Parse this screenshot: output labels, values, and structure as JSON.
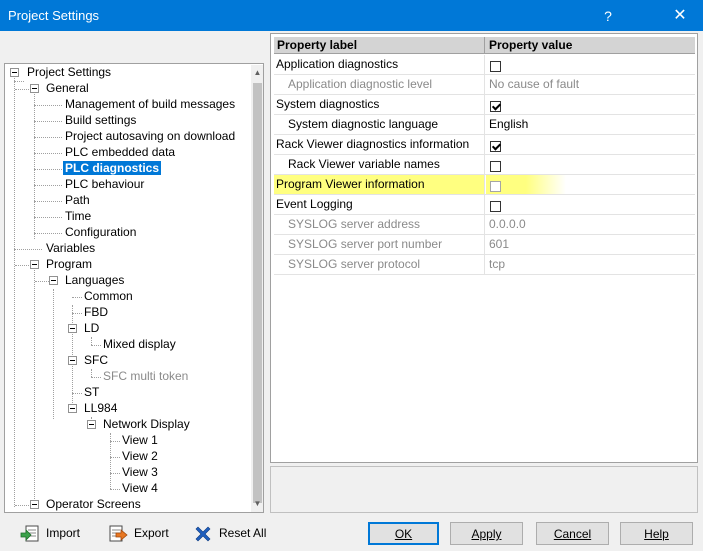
{
  "window": {
    "title": "Project Settings",
    "help_label": "?",
    "close_label": "✕"
  },
  "tree": {
    "nodes": [
      {
        "id": "project-settings",
        "label": "Project Settings"
      },
      {
        "id": "general",
        "label": "General"
      },
      {
        "id": "mgmt",
        "label": "Management of build messages"
      },
      {
        "id": "build",
        "label": "Build settings"
      },
      {
        "id": "autosave",
        "label": "Project autosaving on download"
      },
      {
        "id": "embedded",
        "label": "PLC embedded data"
      },
      {
        "id": "diagnostics",
        "label": "PLC diagnostics"
      },
      {
        "id": "behaviour",
        "label": "PLC behaviour"
      },
      {
        "id": "path",
        "label": "Path"
      },
      {
        "id": "time",
        "label": "Time"
      },
      {
        "id": "configuration",
        "label": "Configuration"
      },
      {
        "id": "variables",
        "label": "Variables"
      },
      {
        "id": "program",
        "label": "Program"
      },
      {
        "id": "languages",
        "label": "Languages"
      },
      {
        "id": "common",
        "label": "Common"
      },
      {
        "id": "fbd",
        "label": "FBD"
      },
      {
        "id": "ld",
        "label": "LD"
      },
      {
        "id": "mixed",
        "label": "Mixed display"
      },
      {
        "id": "sfc",
        "label": "SFC"
      },
      {
        "id": "sfcmulti",
        "label": "SFC multi token"
      },
      {
        "id": "st",
        "label": "ST"
      },
      {
        "id": "ll984",
        "label": "LL984"
      },
      {
        "id": "netdisplay",
        "label": "Network Display"
      },
      {
        "id": "view1",
        "label": "View 1"
      },
      {
        "id": "view2",
        "label": "View 2"
      },
      {
        "id": "view3",
        "label": "View 3"
      },
      {
        "id": "view4",
        "label": "View 4"
      },
      {
        "id": "operator",
        "label": "Operator Screens"
      }
    ],
    "selected": "PLC diagnostics"
  },
  "grid": {
    "header_label": "Property label",
    "header_value": "Property value",
    "rows": [
      {
        "label": "Application diagnostics",
        "checkbox": true,
        "checked": false
      },
      {
        "label": "Application diagnostic level",
        "value": "No cause of fault"
      },
      {
        "label": "System diagnostics",
        "checkbox": true,
        "checked": true
      },
      {
        "label": "System diagnostic language",
        "value": "English"
      },
      {
        "label": "Rack Viewer diagnostics information",
        "checkbox": true,
        "checked": true
      },
      {
        "label": "Rack Viewer variable names",
        "checkbox": true,
        "checked": false
      },
      {
        "label": "Program Viewer information",
        "checkbox": true,
        "checked": false
      },
      {
        "label": "Event Logging",
        "checkbox": true,
        "checked": false
      },
      {
        "label": "SYSLOG server address",
        "value": "0.0.0.0"
      },
      {
        "label": "SYSLOG server port number",
        "value": "601"
      },
      {
        "label": "SYSLOG server protocol",
        "value": "tcp"
      }
    ]
  },
  "toolbar": {
    "import_label": "Import",
    "export_label": "Export",
    "reset_label": "Reset All"
  },
  "buttons": {
    "ok": "OK",
    "apply": "Apply",
    "cancel": "Cancel",
    "help": "Help"
  },
  "colors": {
    "titlebar": "#0078d7",
    "selection": "#0078d7",
    "highlight": "#ffff80"
  }
}
